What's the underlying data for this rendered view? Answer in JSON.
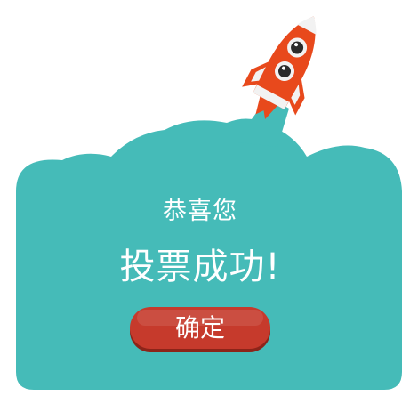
{
  "dialog": {
    "greeting": "恭喜您",
    "headline": "投票成功!",
    "confirm_label": "确定"
  },
  "colors": {
    "cloud": "#45bbb8",
    "rocket_body": "#e8491c",
    "button": "#c63a2c",
    "text": "#ffffff"
  },
  "icons": {
    "illustration": "rocket-icon"
  }
}
